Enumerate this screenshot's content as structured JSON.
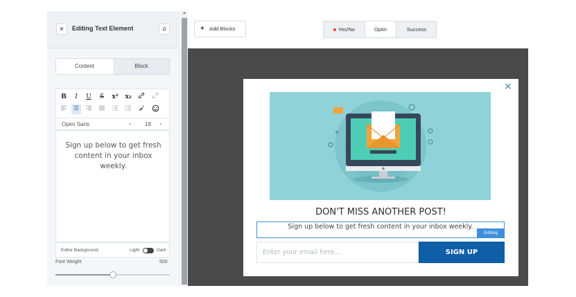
{
  "panel": {
    "title": "Editing Text Element",
    "close_icon": "×",
    "pin_icon": "⌂",
    "tabs": [
      {
        "label": "Content",
        "active": true
      },
      {
        "label": "Block",
        "active": false
      }
    ],
    "toolbar": {
      "row1": [
        {
          "icon": "bold-icon",
          "glyph": "B",
          "style": "bold"
        },
        {
          "icon": "italic-icon",
          "glyph": "I",
          "style": "italic"
        },
        {
          "icon": "underline-icon",
          "glyph": "U",
          "style": "underline"
        },
        {
          "icon": "strikethrough-icon",
          "glyph": "S",
          "style": "strike"
        },
        {
          "icon": "superscript-icon",
          "glyph": "x²",
          "style": "bold"
        },
        {
          "icon": "subscript-icon",
          "glyph": "x₂",
          "style": "bold"
        },
        {
          "icon": "link-icon",
          "glyph": "🔗",
          "style": ""
        },
        {
          "icon": "unlink-icon",
          "glyph": "⛓",
          "style": "light"
        }
      ],
      "row2": [
        {
          "icon": "align-left-icon",
          "glyph": "≡",
          "style": "light"
        },
        {
          "icon": "align-center-icon",
          "glyph": "≡",
          "style": "active"
        },
        {
          "icon": "align-right-icon",
          "glyph": "≡",
          "style": "light"
        },
        {
          "icon": "align-justify-icon",
          "glyph": "≡",
          "style": "light"
        },
        {
          "icon": "bullet-list-icon",
          "glyph": "☰",
          "style": "light"
        },
        {
          "icon": "numbered-list-icon",
          "glyph": "☷",
          "style": "light"
        },
        {
          "icon": "color-picker-icon",
          "glyph": "✎",
          "style": ""
        },
        {
          "icon": "emoji-icon",
          "glyph": "☺",
          "style": ""
        }
      ]
    },
    "font_family": "Open Sans",
    "font_size": "18",
    "caret": "⌄",
    "editor_text": "Sign up below to get fresh content in your inbox weekly.",
    "editor_background_label": "Editor Background:",
    "light_label": "Light",
    "dark_label": "Dark",
    "font_weight_label": "Font Weight",
    "font_weight_value": "500",
    "font_weight_fraction": 0.5
  },
  "topbar": {
    "add_blocks_icon": "+",
    "add_blocks_label": "Add Blocks",
    "steps": [
      {
        "label": "Yes/No",
        "has_dot": true
      },
      {
        "label": "Optin",
        "active": true
      },
      {
        "label": "Success"
      }
    ]
  },
  "popup": {
    "close_icon": "×",
    "headline": "DON'T MISS ANOTHER POST!",
    "subtext": "Sign up below to get fresh content in your inbox weekly.",
    "editing_badge": "Editing",
    "email_placeholder": "Enter your email here...",
    "signup_label": "SIGN UP"
  },
  "colors": {
    "accent_blue": "#3d8fdc",
    "button_blue": "#0f5ea8",
    "illustration_bg": "#8fd3d9",
    "canvas_bg": "#4a4a4a"
  }
}
